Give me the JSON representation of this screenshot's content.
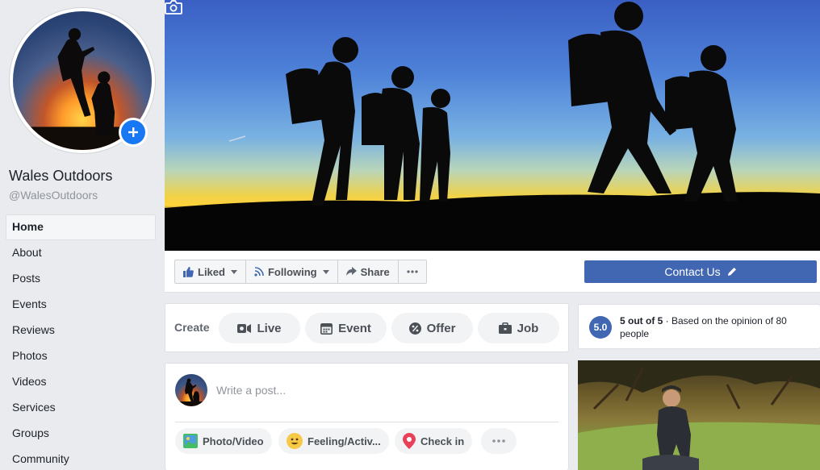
{
  "page": {
    "name": "Wales Outdoors",
    "handle": "@WalesOutdoors"
  },
  "nav": {
    "items": [
      {
        "label": "Home",
        "active": true
      },
      {
        "label": "About"
      },
      {
        "label": "Posts"
      },
      {
        "label": "Events"
      },
      {
        "label": "Reviews"
      },
      {
        "label": "Photos"
      },
      {
        "label": "Videos"
      },
      {
        "label": "Services"
      },
      {
        "label": "Groups"
      },
      {
        "label": "Community"
      }
    ]
  },
  "actions": {
    "liked_label": "Liked",
    "following_label": "Following",
    "share_label": "Share",
    "contact_label": "Contact Us"
  },
  "create": {
    "label": "Create",
    "live": "Live",
    "event": "Event",
    "offer": "Offer",
    "job": "Job"
  },
  "composer": {
    "placeholder": "Write a post...",
    "photo_video": "Photo/Video",
    "feeling": "Feeling/Activ...",
    "check_in": "Check in"
  },
  "rating": {
    "score": "5.0",
    "headline": "5 out of 5",
    "detail": " · Based on the opinion of 80 people"
  },
  "colors": {
    "brand_blue": "#4267b2",
    "accent_blue": "#1877f2",
    "background": "#e9ebee"
  },
  "icons": [
    "camera-icon",
    "plus-icon",
    "thumbs-up-icon",
    "rss-icon",
    "share-arrow-icon",
    "more-dots-icon",
    "pencil-icon",
    "video-camera-icon",
    "calendar-icon",
    "percent-icon",
    "briefcase-icon",
    "photo-icon",
    "smiley-icon",
    "location-pin-icon"
  ]
}
